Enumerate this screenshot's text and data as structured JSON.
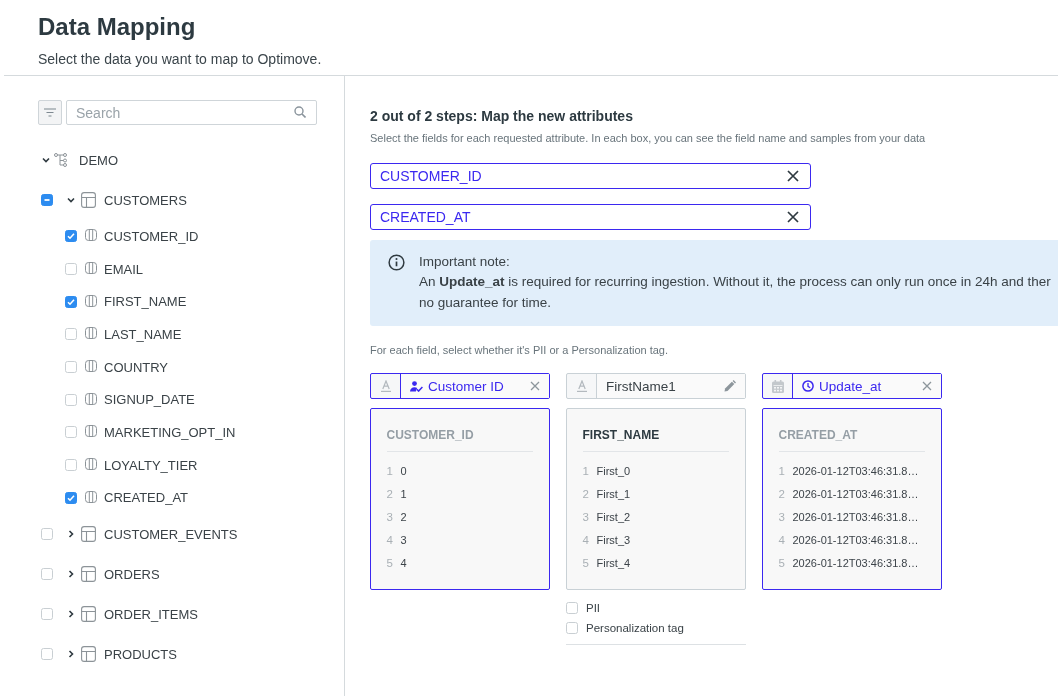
{
  "header": {
    "title": "Data Mapping",
    "subtitle": "Select the data you want to map to Optimove."
  },
  "sidebar": {
    "search": {
      "placeholder": "Search"
    },
    "tree": [
      {
        "label": "DEMO",
        "expanded": true,
        "children": [
          {
            "label": "CUSTOMERS",
            "expanded": true,
            "checked": false,
            "indeterminate": true,
            "children": [
              {
                "label": "CUSTOMER_ID",
                "checked": true
              },
              {
                "label": "EMAIL",
                "checked": false
              },
              {
                "label": "FIRST_NAME",
                "checked": true
              },
              {
                "label": "LAST_NAME",
                "checked": false
              },
              {
                "label": "COUNTRY",
                "checked": false
              },
              {
                "label": "SIGNUP_DATE",
                "checked": false
              },
              {
                "label": "MARKETING_OPT_IN",
                "checked": false
              },
              {
                "label": "LOYALTY_TIER",
                "checked": false
              },
              {
                "label": "CREATED_AT",
                "checked": true
              }
            ]
          },
          {
            "label": "CUSTOMER_EVENTS",
            "expanded": false,
            "checked": false,
            "indeterminate": false
          },
          {
            "label": "ORDERS",
            "expanded": false,
            "checked": false,
            "indeterminate": false
          },
          {
            "label": "ORDER_ITEMS",
            "expanded": false,
            "checked": false,
            "indeterminate": false
          },
          {
            "label": "PRODUCTS",
            "expanded": false,
            "checked": false,
            "indeterminate": false
          }
        ]
      }
    ]
  },
  "main": {
    "step_title": "2 out of 2 steps: Map the new attributes",
    "step_description": "Select the fields for each requested attribute. In each box, you can see the field name and samples from your data",
    "selected_fields": [
      {
        "value": "CUSTOMER_ID"
      },
      {
        "value": "CREATED_AT"
      }
    ],
    "note": {
      "title": "Important note:",
      "lines": [
        "An **Update_at** is required for recurring ingestion. Without it, the process can only run once in 24h and ther",
        "no guarantee for time."
      ]
    },
    "tag_hint": "For each field, select whether it's PII or a Personalization tag.",
    "mappings": [
      {
        "kind": "identifier",
        "type_badge": {
          "kind": "text"
        },
        "attribute": "Customer ID",
        "field": "CUSTOMER_ID",
        "samples": [
          {
            "index": "1",
            "value": "0"
          },
          {
            "index": "2",
            "value": "1"
          },
          {
            "index": "3",
            "value": "2"
          },
          {
            "index": "4",
            "value": "3"
          },
          {
            "index": "5",
            "value": "4"
          }
        ]
      },
      {
        "kind": "custom",
        "type_badge": {
          "kind": "text"
        },
        "attribute": "FirstName1",
        "field": "FIRST_NAME",
        "samples": [
          {
            "index": "1",
            "value": "First_0"
          },
          {
            "index": "2",
            "value": "First_1"
          },
          {
            "index": "3",
            "value": "First_2"
          },
          {
            "index": "4",
            "value": "First_3"
          },
          {
            "index": "5",
            "value": "First_4"
          }
        ],
        "options": [
          {
            "label": "PII",
            "checked": false
          },
          {
            "label": "Personalization tag",
            "checked": false
          }
        ]
      },
      {
        "kind": "timestamp",
        "type_badge": {
          "kind": "date"
        },
        "attribute": "Update_at",
        "field": "CREATED_AT",
        "samples": [
          {
            "index": "1",
            "value": "2026-01-12T03:46:31.8…"
          },
          {
            "index": "2",
            "value": "2026-01-12T03:46:31.8…"
          },
          {
            "index": "3",
            "value": "2026-01-12T03:46:31.8…"
          },
          {
            "index": "4",
            "value": "2026-01-12T03:46:31.8…"
          },
          {
            "index": "5",
            "value": "2026-01-12T03:46:31.8…"
          }
        ]
      }
    ]
  }
}
